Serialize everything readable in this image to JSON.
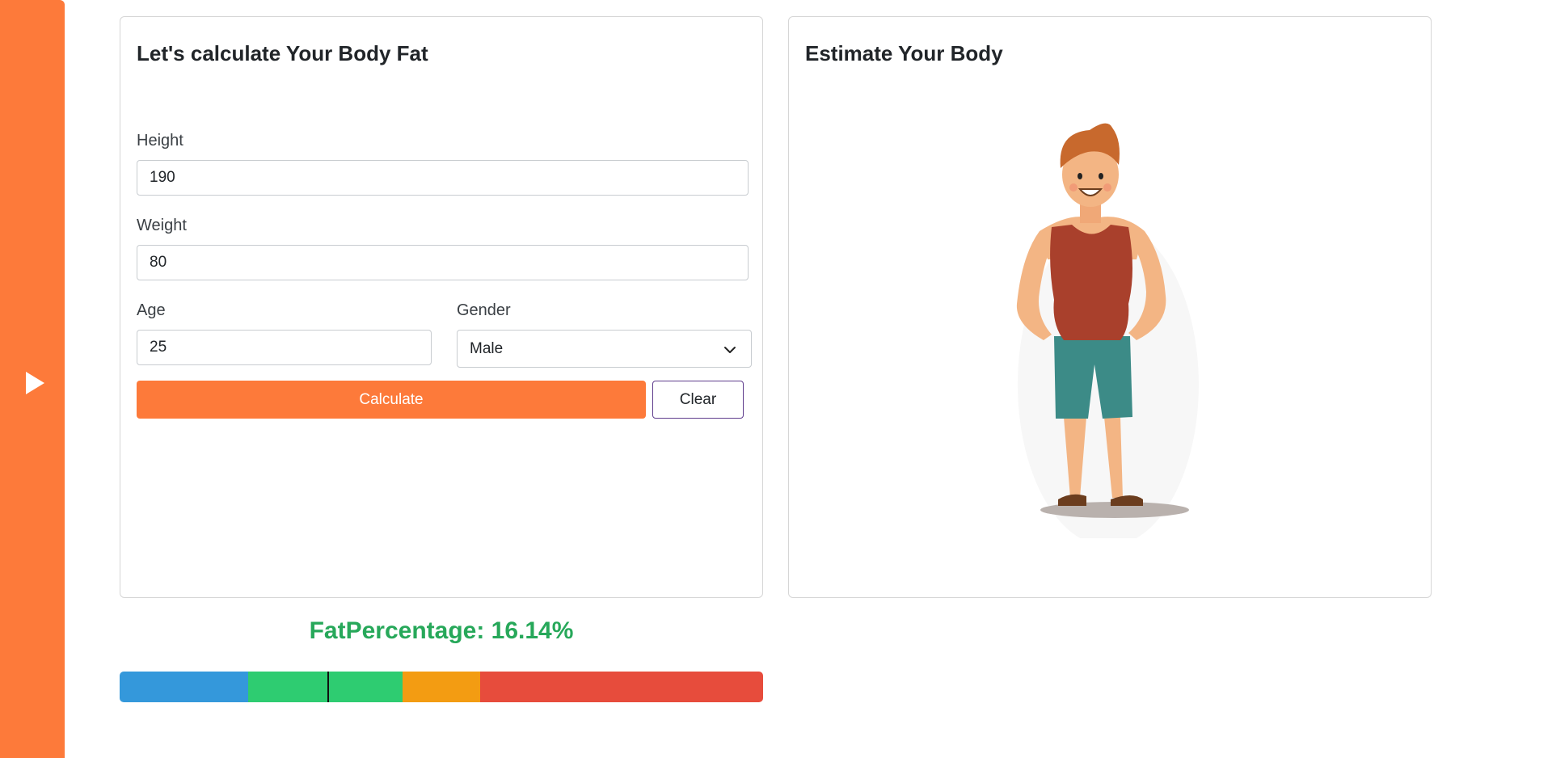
{
  "sidebar": {
    "toggle_icon": "play-triangle-icon",
    "color": "#fd7a3a"
  },
  "calculator": {
    "title": "Let's calculate Your Body Fat",
    "height": {
      "label": "Height",
      "value": "190"
    },
    "weight": {
      "label": "Weight",
      "value": "80"
    },
    "age": {
      "label": "Age",
      "value": "25"
    },
    "gender": {
      "label": "Gender",
      "selected": "Male"
    },
    "calculate_label": "Calculate",
    "clear_label": "Clear"
  },
  "estimate": {
    "title": "Estimate Your Body",
    "figure_icon": "standing-man-illustration"
  },
  "result": {
    "text": "FatPercentage: 16.14%",
    "value_percent": 16.14,
    "color": "#27a85a"
  },
  "fat_scale": {
    "segments": [
      {
        "color": "#3498db",
        "share": 0.2
      },
      {
        "color": "#2ecc71",
        "share": 0.24
      },
      {
        "color": "#f39c12",
        "share": 0.12
      },
      {
        "color": "#e74c3c",
        "share": 0.44
      }
    ],
    "marker_position": 0.323
  },
  "colors": {
    "accent": "#fd7a3a",
    "clear_border": "#5e3b8c"
  }
}
